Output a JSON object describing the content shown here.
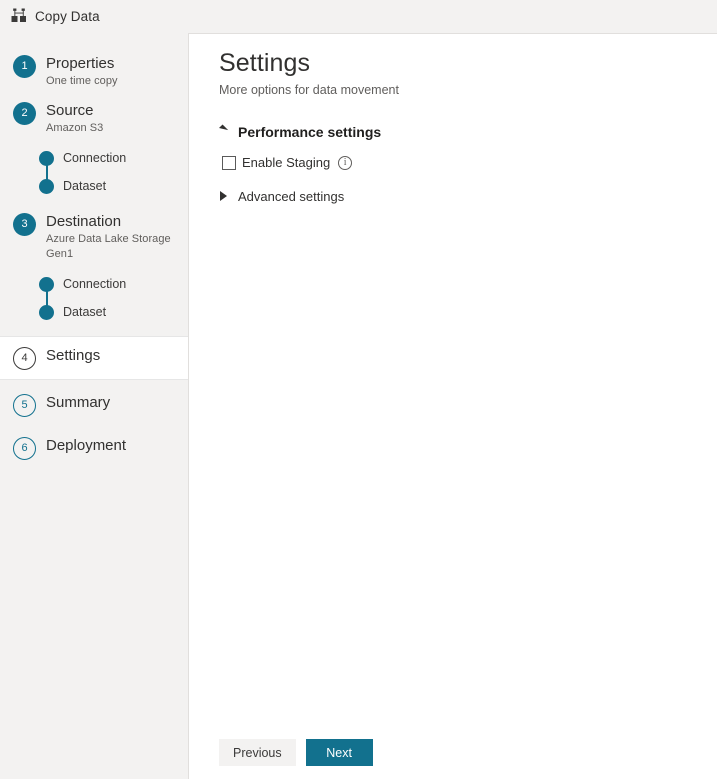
{
  "window": {
    "title": "Copy Data",
    "icon": "copy-data-icon"
  },
  "theme": {
    "accent": "#12718e",
    "sidebar_bg": "#f3f2f1",
    "panel_bg": "#ffffff",
    "text": "#323130",
    "muted_text": "#605e5c"
  },
  "sidebar": {
    "steps": [
      {
        "number": "1",
        "label": "Properties",
        "sub": "One time copy",
        "state": "complete",
        "substeps": []
      },
      {
        "number": "2",
        "label": "Source",
        "sub": "Amazon S3",
        "state": "complete",
        "substeps": [
          {
            "label": "Connection"
          },
          {
            "label": "Dataset"
          }
        ]
      },
      {
        "number": "3",
        "label": "Destination",
        "sub": "Azure Data Lake Storage Gen1",
        "state": "complete",
        "substeps": [
          {
            "label": "Connection"
          },
          {
            "label": "Dataset"
          }
        ]
      },
      {
        "number": "4",
        "label": "Settings",
        "sub": "",
        "state": "selected",
        "substeps": []
      },
      {
        "number": "5",
        "label": "Summary",
        "sub": "",
        "state": "pending",
        "substeps": []
      },
      {
        "number": "6",
        "label": "Deployment",
        "sub": "",
        "state": "pending",
        "substeps": []
      }
    ]
  },
  "main": {
    "title": "Settings",
    "subtitle": "More options for data movement",
    "performance_section": {
      "title": "Performance settings",
      "expanded": true,
      "enable_staging": {
        "label": "Enable Staging",
        "checked": false,
        "info": "i"
      }
    },
    "advanced_section": {
      "title": "Advanced settings",
      "expanded": false
    }
  },
  "footer": {
    "previous_label": "Previous",
    "next_label": "Next"
  }
}
